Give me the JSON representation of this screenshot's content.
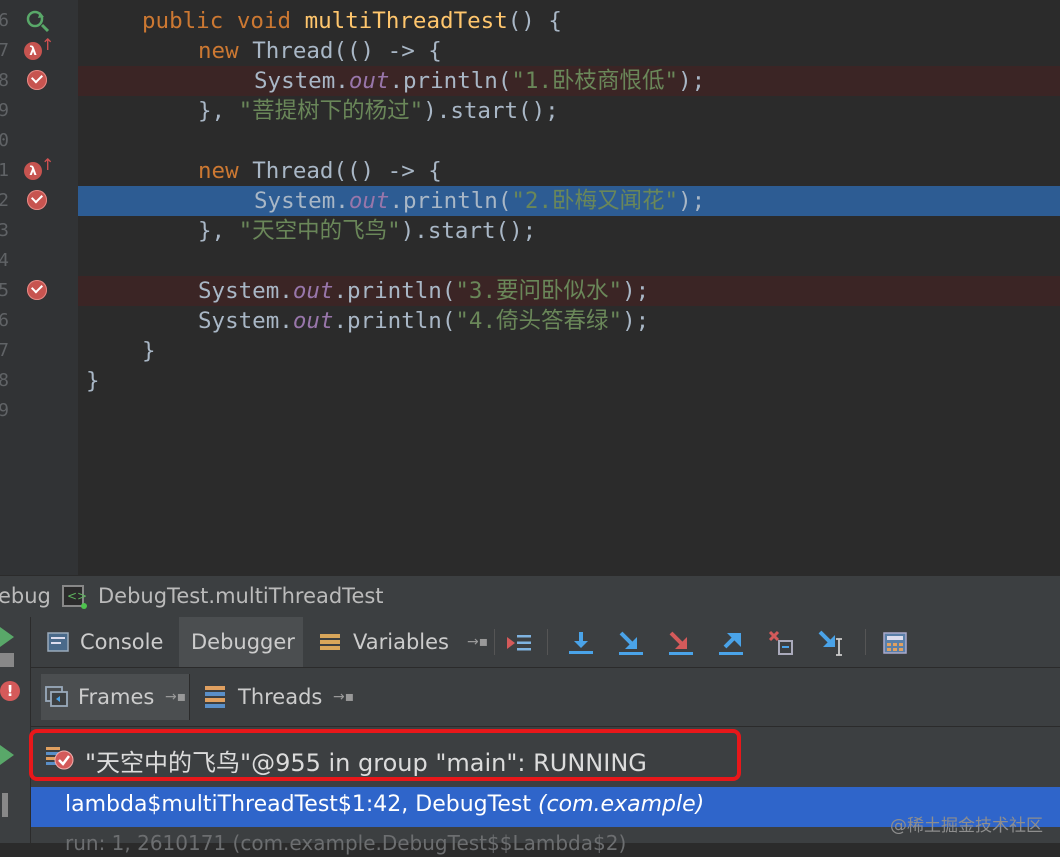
{
  "editor": {
    "line_numbers": [
      "6",
      "7",
      "8",
      "9",
      "0",
      "1",
      "2",
      "3",
      "4",
      "5",
      "6",
      "7",
      "8",
      "9"
    ],
    "lines": [
      [
        {
          "c": "kw",
          "t": "public "
        },
        {
          "c": "kw",
          "t": "void "
        },
        {
          "c": "fn",
          "t": "multiThreadTest"
        },
        {
          "c": "",
          "t": "() {"
        }
      ],
      [
        {
          "c": "kw",
          "t": "new "
        },
        {
          "c": "",
          "t": "Thread(() -> {"
        }
      ],
      [
        {
          "c": "",
          "t": "System."
        },
        {
          "c": "fd",
          "t": "out"
        },
        {
          "c": "",
          "t": ".println("
        },
        {
          "c": "st",
          "t": "\"1.卧枝商恨低\""
        },
        {
          "c": "",
          "t": ");"
        }
      ],
      [
        {
          "c": "",
          "t": "}, "
        },
        {
          "c": "st",
          "t": "\"菩提树下的杨过\""
        },
        {
          "c": "",
          "t": ").start();"
        }
      ],
      [],
      [
        {
          "c": "kw",
          "t": "new "
        },
        {
          "c": "",
          "t": "Thread(() -> {"
        }
      ],
      [
        {
          "c": "",
          "t": "System."
        },
        {
          "c": "fd",
          "t": "out"
        },
        {
          "c": "",
          "t": ".println("
        },
        {
          "c": "st",
          "t": "\"2.卧梅又闻花\""
        },
        {
          "c": "",
          "t": ");"
        }
      ],
      [
        {
          "c": "",
          "t": "}, "
        },
        {
          "c": "st",
          "t": "\"天空中的飞鸟\""
        },
        {
          "c": "",
          "t": ").start();"
        }
      ],
      [],
      [
        {
          "c": "",
          "t": "System."
        },
        {
          "c": "fd",
          "t": "out"
        },
        {
          "c": "",
          "t": ".println("
        },
        {
          "c": "st",
          "t": "\"3.要问卧似水\""
        },
        {
          "c": "",
          "t": ");"
        }
      ],
      [
        {
          "c": "",
          "t": "System."
        },
        {
          "c": "fd",
          "t": "out"
        },
        {
          "c": "",
          "t": ".println("
        },
        {
          "c": "st",
          "t": "\"4.倚头答春绿\""
        },
        {
          "c": "",
          "t": ");"
        }
      ],
      [
        {
          "c": "",
          "t": "}"
        }
      ],
      [
        {
          "c": "",
          "t": "}"
        }
      ],
      []
    ]
  },
  "debug": {
    "title_label": "ebug",
    "config_name": "DebugTest.multiThreadTest",
    "tabs": {
      "console": "Console",
      "debugger": "Debugger",
      "variables": "Variables"
    },
    "subtabs": {
      "frames": "Frames",
      "threads": "Threads"
    },
    "thread_status": "\"天空中的飞鸟\"@955 in group \"main\": RUNNING",
    "frame_selected": "lambda$multiThreadTest$1:42, DebugTest ",
    "frame_selected_pkg": "(com.example)",
    "frame_next": "run: 1, 2610171 (com.example.DebugTest$$Lambda$2)"
  },
  "watermark": "@稀土掘金技术社区",
  "icons": {
    "gutter_reload": "reload-icon",
    "gutter_lambda": "lambda-breakpoint-icon",
    "breakpoint": "breakpoint-icon"
  },
  "colors": {
    "editor_bg": "#2b2b2b",
    "keyword": "#cc7832",
    "string": "#6a8759",
    "function": "#ffc66d",
    "field": "#9876aa",
    "current_line": "#2d5c93",
    "breakpoint_line": "#3b2525",
    "selection": "#2f65ca",
    "highlight_box": "#e8171a"
  }
}
